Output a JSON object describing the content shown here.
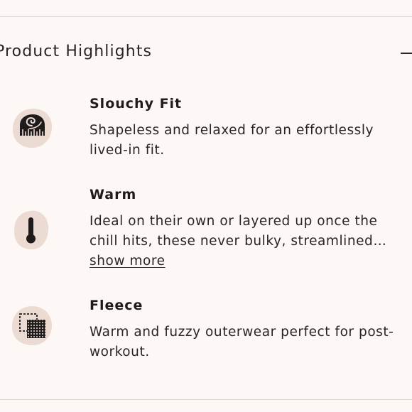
{
  "section": {
    "title": "Product Highlights",
    "collapse_icon": "minus-icon"
  },
  "highlights": [
    {
      "title": "Slouchy Fit",
      "icon": "tape-measure-icon",
      "description_lines": [
        "Shapeless and relaxed for an effortlessly",
        "lived-in fit."
      ]
    },
    {
      "title": "Warm",
      "icon": "thermometer-icon",
      "description_lines": [
        "Ideal on their own or layered up once the",
        "chill hits, these never bulky, streamlined…"
      ],
      "show_more_label": "show more"
    },
    {
      "title": "Fleece",
      "icon": "fabric-swatch-icon",
      "description_lines": [
        "Warm and fuzzy outerwear perfect for post-",
        "workout."
      ]
    }
  ],
  "colors": {
    "background": "#fdf8f6",
    "icon_blob": "#ecdbd2",
    "text": "#1f1b1a",
    "divider": "#dcd6d3"
  }
}
